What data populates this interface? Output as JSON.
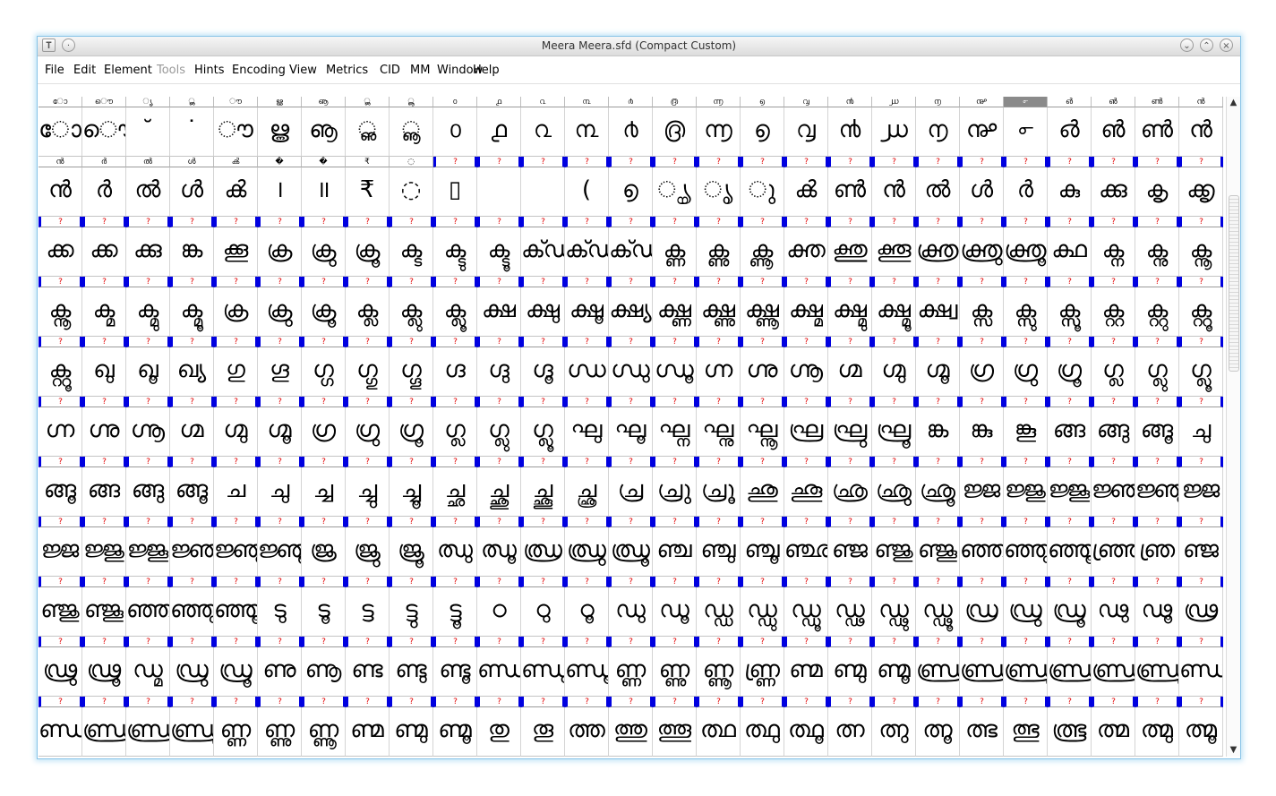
{
  "window": {
    "title": "Meera  Meera.sfd (Compact Custom)",
    "icons": [
      "app-icon",
      "sticky-icon",
      "minimize-icon",
      "maximize-icon",
      "close-icon"
    ]
  },
  "menu": [
    "File",
    "Edit",
    "Element",
    "Tools",
    "Hints",
    "Encoding",
    "View",
    "Metrics",
    "CID",
    "MM",
    "Window",
    "Help"
  ],
  "menu_disabled": [
    "Tools"
  ],
  "grid": {
    "columns": 27,
    "selected_cell": {
      "row": 0,
      "col": 22
    },
    "rows": [
      {
        "labels": [
          "ോ",
          "ൌ",
          "ൃ",
          "ൢ",
          "ൗ",
          "ൠ",
          "ൡ",
          "ൢ",
          "ൣ",
          "൦",
          "൧",
          "൨",
          "൩",
          "൪",
          "൫",
          "൬",
          "൭",
          "൮",
          "൯",
          "൰",
          "൱",
          "൲",
          "൳",
          "൴",
          "൵",
          "ൺ",
          "ൻ"
        ],
        "glyphs": [
          "ോ",
          "ൌ",
          "˘",
          "˙",
          "ൗ",
          "ൠ",
          "ൡ",
          "ൢ",
          "ൣ",
          "൦",
          "൧",
          "൨",
          "൩",
          "൪",
          "൫",
          "൬",
          "൭",
          "൮",
          "൯",
          "൰",
          "൱",
          "൲",
          "൳",
          "൴",
          "൵",
          "ൺ",
          "ൻ"
        ]
      },
      {
        "labels": [
          "ൻ",
          "ർ",
          "ൽ",
          "ൾ",
          "ൿ",
          "�",
          "�",
          "₹",
          "◌",
          "?",
          "?",
          "?",
          "?",
          "?",
          "?",
          "?",
          "?",
          "?",
          "?",
          "?",
          "?",
          "?",
          "?",
          "?",
          "?",
          "?",
          "?"
        ],
        "glyphs": [
          "ൻ",
          "ർ",
          "ൽ",
          "ൾ",
          "ൿ",
          "।",
          "॥",
          "₹",
          "◌",
          "▯",
          "",
          "",
          "(",
          "൭",
          "ൄ",
          "ൃ",
          "ു",
          "ൿ",
          "ൺ",
          "ൻ",
          "ൽ",
          "ൾ",
          "ർ",
          "കു",
          "ക്കു",
          "കൃ",
          "ക്കൃ"
        ]
      },
      {
        "labels": [
          "?",
          "?",
          "?",
          "?",
          "?",
          "?",
          "?",
          "?",
          "?",
          "?",
          "?",
          "?",
          "?",
          "?",
          "?",
          "?",
          "?",
          "?",
          "?",
          "?",
          "?",
          "?",
          "?",
          "?",
          "?",
          "?",
          "?"
        ],
        "glyphs": [
          "ക്ക",
          "ക്ക",
          "ക്കു",
          "ങ്ക",
          "ക്കൂ",
          "ക്ര",
          "ക്രു",
          "ക്രൂ",
          "ക്ട",
          "ക്ടു",
          "ക്ടൂ",
          "ക്ഢ",
          "ക്ഢു",
          "ക്ഢൂ",
          "ക്ണ",
          "ക്ണു",
          "ക്ണൂ",
          "ക്ത",
          "ക്തു",
          "ക്തൂ",
          "ക്ത്ര",
          "ക്ത്രു",
          "ക്ത്രൂ",
          "ക്ഥ",
          "ക്ന",
          "ക്നു",
          "ക്നൂ"
        ]
      },
      {
        "labels": [
          "?",
          "?",
          "?",
          "?",
          "?",
          "?",
          "?",
          "?",
          "?",
          "?",
          "?",
          "?",
          "?",
          "?",
          "?",
          "?",
          "?",
          "?",
          "?",
          "?",
          "?",
          "?",
          "?",
          "?",
          "?",
          "?",
          "?"
        ],
        "glyphs": [
          "ക്നൂ",
          "ക്മ",
          "ക്മു",
          "ക്മൂ",
          "ക്ര",
          "ക്രു",
          "ക്രൂ",
          "ക്ല",
          "ക്ലു",
          "ക്ലൂ",
          "ക്ഷ",
          "ക്ഷു",
          "ക്ഷൂ",
          "ക്ഷ്യ",
          "ക്ഷ്ണ",
          "ക്ഷ്ണു",
          "ക്ഷ്ണൂ",
          "ക്ഷ്മ",
          "ക്ഷ്മു",
          "ക്ഷ്മൂ",
          "ക്ഷ്വ",
          "ക്സ",
          "ക്സു",
          "ക്സൂ",
          "ക്റ്റ",
          "ക്റ്റു",
          "ക്റ്റൂ"
        ]
      },
      {
        "labels": [
          "?",
          "?",
          "?",
          "?",
          "?",
          "?",
          "?",
          "?",
          "?",
          "?",
          "?",
          "?",
          "?",
          "?",
          "?",
          "?",
          "?",
          "?",
          "?",
          "?",
          "?",
          "?",
          "?",
          "?",
          "?",
          "?",
          "?"
        ],
        "glyphs": [
          "ക്റ്റൂ",
          "ഖു",
          "ഖൂ",
          "ഖ്യ",
          "ഗു",
          "ഗൂ",
          "ഗ്ഗ",
          "ഗ്ഗു",
          "ഗ്ഗൂ",
          "ഗ്ദ",
          "ഗ്ദു",
          "ഗ്ദൂ",
          "ഗ്ധ",
          "ഗ്ധു",
          "ഗ്ധൂ",
          "ഗ്ന",
          "ഗ്നു",
          "ഗ്നൂ",
          "ഗ്മ",
          "ഗ്മു",
          "ഗ്മൂ",
          "ഗ്ര",
          "ഗ്രു",
          "ഗ്രൂ",
          "ഗ്ല",
          "ഗ്ലു",
          "ഗ്ലൂ"
        ]
      },
      {
        "labels": [
          "?",
          "?",
          "?",
          "?",
          "?",
          "?",
          "?",
          "?",
          "?",
          "?",
          "?",
          "?",
          "?",
          "?",
          "?",
          "?",
          "?",
          "?",
          "?",
          "?",
          "?",
          "?",
          "?",
          "?",
          "?",
          "?",
          "?"
        ],
        "glyphs": [
          "ഗ്ന",
          "ഗ്നു",
          "ഗ്നൂ",
          "ഗ്മ",
          "ഗ്മു",
          "ഗ്മൂ",
          "ഗ്ര",
          "ഗ്രു",
          "ഗ്രൂ",
          "ഗ്ല",
          "ഗ്ലു",
          "ഗ്ലൂ",
          "ഘു",
          "ഘൂ",
          "ഘ്ന",
          "ഘ്നു",
          "ഘ്നൂ",
          "ഘ്ര",
          "ഘ്രു",
          "ഘ്രൂ",
          "ങ്ക",
          "ങ്കു",
          "ങ്കൂ",
          "ങ്ങ",
          "ങ്ങു",
          "ങ്ങൂ",
          "ചു"
        ]
      },
      {
        "labels": [
          "?",
          "?",
          "?",
          "?",
          "?",
          "?",
          "?",
          "?",
          "?",
          "?",
          "?",
          "?",
          "?",
          "?",
          "?",
          "?",
          "?",
          "?",
          "?",
          "?",
          "?",
          "?",
          "?",
          "?",
          "?",
          "?",
          "?"
        ],
        "glyphs": [
          "ങ്ങൂ",
          "ങ്ങ",
          "ങ്ങു",
          "ങ്ങൂ",
          "ച",
          "ചു",
          "ച്ച",
          "ച്ചു",
          "ച്ചൂ",
          "ച്ഛ",
          "ച്ഛു",
          "ച്ഛൂ",
          "ച്ഛ്ര",
          "ച്ര",
          "ച്രു",
          "ച്രൂ",
          "ഛു",
          "ഛൂ",
          "ഛ്ര",
          "ഛ്രു",
          "ഛ്രൂ",
          "ജ്ജ",
          "ജ്ജു",
          "ജ്ജൂ",
          "ജ്ഞ",
          "ജ്ഞു",
          "ജ്ജ"
        ]
      },
      {
        "labels": [
          "?",
          "?",
          "?",
          "?",
          "?",
          "?",
          "?",
          "?",
          "?",
          "?",
          "?",
          "?",
          "?",
          "?",
          "?",
          "?",
          "?",
          "?",
          "?",
          "?",
          "?",
          "?",
          "?",
          "?",
          "?",
          "?",
          "?"
        ],
        "glyphs": [
          "ജ്ജ",
          "ജ്ജു",
          "ജ്ജൂ",
          "ജ്ഞ",
          "ജ്ഞു",
          "ജ്ഞൂ",
          "ജ്ര",
          "ജ്രു",
          "ജ്രൂ",
          "ഝു",
          "ഝൂ",
          "ഝ്ര",
          "ഝ്രു",
          "ഝ്രൂ",
          "ഞ്ച",
          "ഞ്ചു",
          "ഞ്ചൂ",
          "ഞ്ഛ",
          "ഞ്ജ",
          "ഞ്ജു",
          "ഞ്ജൂ",
          "ഞ്ഞ",
          "ഞ്ഞു",
          "ഞ്ഞൂ",
          "ഞ്ഞ്ര",
          "ഞ്ര",
          "ഞ്ജ"
        ]
      },
      {
        "labels": [
          "?",
          "?",
          "?",
          "?",
          "?",
          "?",
          "?",
          "?",
          "?",
          "?",
          "?",
          "?",
          "?",
          "?",
          "?",
          "?",
          "?",
          "?",
          "?",
          "?",
          "?",
          "?",
          "?",
          "?",
          "?",
          "?",
          "?"
        ],
        "glyphs": [
          "ഞ്ജു",
          "ഞ്ജൂ",
          "ഞ്ഞ",
          "ഞ്ഞു",
          "ഞ്ഞൂ",
          "ടു",
          "ടൂ",
          "ട്ട",
          "ട്ടു",
          "ട്ടൂ",
          "ഠ",
          "ഠു",
          "ഠൂ",
          "ഡു",
          "ഡൂ",
          "ഡ്ഡ",
          "ഡ്ഡു",
          "ഡ്ഡൂ",
          "ഡ്ഢ",
          "ഡ്ഢു",
          "ഡ്ഢൂ",
          "ഡ്ര",
          "ഡ്രു",
          "ഡ്രൂ",
          "ഢു",
          "ഢൂ",
          "ഢ്ര"
        ]
      },
      {
        "labels": [
          "?",
          "?",
          "?",
          "?",
          "?",
          "?",
          "?",
          "?",
          "?",
          "?",
          "?",
          "?",
          "?",
          "?",
          "?",
          "?",
          "?",
          "?",
          "?",
          "?",
          "?",
          "?",
          "?",
          "?",
          "?",
          "?",
          "?"
        ],
        "glyphs": [
          "ഢ്രു",
          "ഢ്രൂ",
          "ഡ്മ",
          "ഡ്രു",
          "ഡ്രൂ",
          "ണു",
          "ണൂ",
          "ണ്ട",
          "ണ്ടു",
          "ണ്ടൂ",
          "ണ്ഡ",
          "ണ്ഡു",
          "ണ്ഡൂ",
          "ണ്ണ",
          "ണ്ണു",
          "ണ്ണൂ",
          "ണ്ണ്ര",
          "ണ്മ",
          "ണ്മു",
          "ണ്മൂ",
          "ണ്ഡ്ര",
          "ണ്ഡ്രു",
          "ണ്ഡ്രൂ",
          "ണ്ഡ്ര",
          "ണ്ഡ്രു",
          "ണ്ഡ്രൂ",
          "ണ്ഡ്യ"
        ]
      },
      {
        "labels": [
          "?",
          "?",
          "?",
          "?",
          "?",
          "?",
          "?",
          "?",
          "?",
          "?",
          "?",
          "?",
          "?",
          "?",
          "?",
          "?",
          "?",
          "?",
          "?",
          "?",
          "?",
          "?",
          "?",
          "?",
          "?",
          "?",
          "?"
        ],
        "glyphs": [
          "ണ്ഡ്യു",
          "ണ്ഡ്ര",
          "ണ്ഡ്രു",
          "ണ്ഡ്രൂ",
          "ണ്ണ",
          "ണ്ണു",
          "ണ്ണൂ",
          "ണ്മ",
          "ണ്മു",
          "ണ്മൂ",
          "തു",
          "തൂ",
          "ത്ത",
          "ത്തു",
          "ത്തൂ",
          "ത്ഥ",
          "ത്ഥു",
          "ത്ഥൂ",
          "ത്ന",
          "ത്നു",
          "ത്നൂ",
          "ത്ഭ",
          "ത്ഭു",
          "ത്ഭൂ",
          "ത്മ",
          "ത്മു",
          "ത്മൂ"
        ]
      }
    ]
  }
}
